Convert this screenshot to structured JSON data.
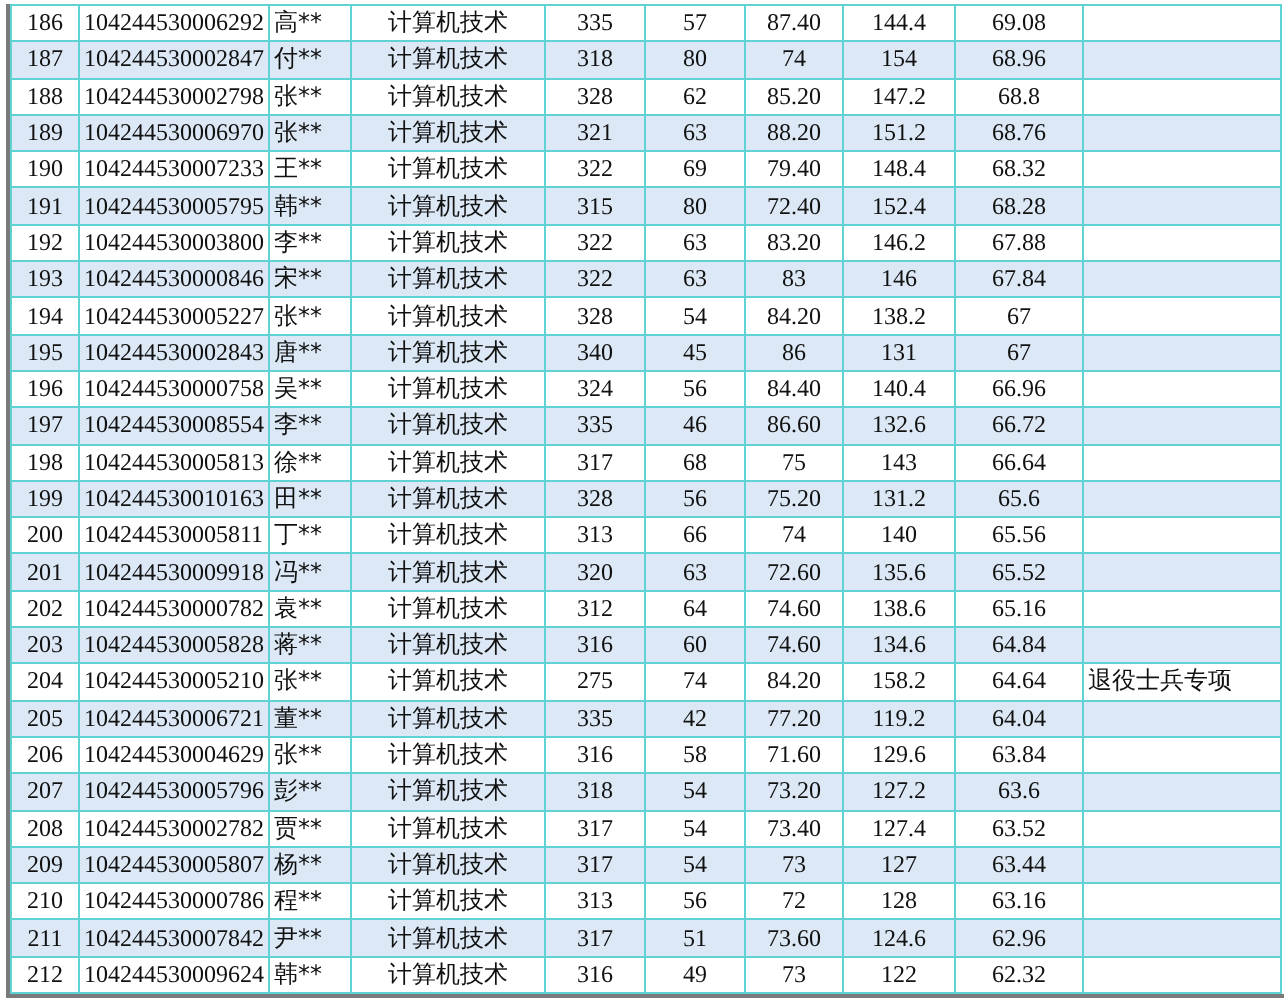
{
  "table": {
    "rows": [
      {
        "cells": [
          "186",
          "104244530006292",
          "高**",
          "计算机技术",
          "335",
          "57",
          "87.40",
          "144.4",
          "69.08"
        ]
      },
      {
        "cells": [
          "187",
          "104244530002847",
          "付**",
          "计算机技术",
          "318",
          "80",
          "74",
          "154",
          "68.96"
        ]
      },
      {
        "cells": [
          "188",
          "104244530002798",
          "张**",
          "计算机技术",
          "328",
          "62",
          "85.20",
          "147.2",
          "68.8"
        ]
      },
      {
        "cells": [
          "189",
          "104244530006970",
          "张**",
          "计算机技术",
          "321",
          "63",
          "88.20",
          "151.2",
          "68.76"
        ]
      },
      {
        "cells": [
          "190",
          "104244530007233",
          "王**",
          "计算机技术",
          "322",
          "69",
          "79.40",
          "148.4",
          "68.32"
        ]
      },
      {
        "cells": [
          "191",
          "104244530005795",
          "韩**",
          "计算机技术",
          "315",
          "80",
          "72.40",
          "152.4",
          "68.28"
        ]
      },
      {
        "cells": [
          "192",
          "104244530003800",
          "李**",
          "计算机技术",
          "322",
          "63",
          "83.20",
          "146.2",
          "67.88"
        ]
      },
      {
        "cells": [
          "193",
          "104244530000846",
          "宋**",
          "计算机技术",
          "322",
          "63",
          "83",
          "146",
          "67.84"
        ]
      },
      {
        "cells": [
          "194",
          "104244530005227",
          "张**",
          "计算机技术",
          "328",
          "54",
          "84.20",
          "138.2",
          "67"
        ]
      },
      {
        "cells": [
          "195",
          "104244530002843",
          "唐**",
          "计算机技术",
          "340",
          "45",
          "86",
          "131",
          "67"
        ]
      },
      {
        "cells": [
          "196",
          "104244530000758",
          "吴**",
          "计算机技术",
          "324",
          "56",
          "84.40",
          "140.4",
          "66.96"
        ]
      },
      {
        "cells": [
          "197",
          "104244530008554",
          "李**",
          "计算机技术",
          "335",
          "46",
          "86.60",
          "132.6",
          "66.72"
        ]
      },
      {
        "cells": [
          "198",
          "104244530005813",
          "徐**",
          "计算机技术",
          "317",
          "68",
          "75",
          "143",
          "66.64"
        ]
      },
      {
        "cells": [
          "199",
          "104244530010163",
          "田**",
          "计算机技术",
          "328",
          "56",
          "75.20",
          "131.2",
          "65.6"
        ]
      },
      {
        "cells": [
          "200",
          "104244530005811",
          "丁**",
          "计算机技术",
          "313",
          "66",
          "74",
          "140",
          "65.56"
        ]
      },
      {
        "cells": [
          "201",
          "104244530009918",
          "冯**",
          "计算机技术",
          "320",
          "63",
          "72.60",
          "135.6",
          "65.52"
        ]
      },
      {
        "cells": [
          "202",
          "104244530000782",
          "袁**",
          "计算机技术",
          "312",
          "64",
          "74.60",
          "138.6",
          "65.16"
        ]
      },
      {
        "cells": [
          "203",
          "104244530005828",
          "蒋**",
          "计算机技术",
          "316",
          "60",
          "74.60",
          "134.6",
          "64.84"
        ]
      },
      {
        "cells": [
          "204",
          "104244530005210",
          "张**",
          "计算机技术",
          "275",
          "74",
          "84.20",
          "158.2",
          "64.64",
          "退役士兵专项"
        ]
      },
      {
        "cells": [
          "205",
          "104244530006721",
          "董**",
          "计算机技术",
          "335",
          "42",
          "77.20",
          "119.2",
          "64.04"
        ]
      },
      {
        "cells": [
          "206",
          "104244530004629",
          "张**",
          "计算机技术",
          "316",
          "58",
          "71.60",
          "129.6",
          "63.84"
        ]
      },
      {
        "cells": [
          "207",
          "104244530005796",
          "彭**",
          "计算机技术",
          "318",
          "54",
          "73.20",
          "127.2",
          "63.6"
        ]
      },
      {
        "cells": [
          "208",
          "104244530002782",
          "贾**",
          "计算机技术",
          "317",
          "54",
          "73.40",
          "127.4",
          "63.52"
        ]
      },
      {
        "cells": [
          "209",
          "104244530005807",
          "杨**",
          "计算机技术",
          "317",
          "54",
          "73",
          "127",
          "63.44"
        ]
      },
      {
        "cells": [
          "210",
          "104244530000786",
          "程**",
          "计算机技术",
          "313",
          "56",
          "72",
          "128",
          "63.16"
        ]
      },
      {
        "cells": [
          "211",
          "104244530007842",
          "尹**",
          "计算机技术",
          "317",
          "51",
          "73.60",
          "124.6",
          "62.96"
        ]
      },
      {
        "cells": [
          "212",
          "104244530009624",
          "韩**",
          "计算机技术",
          "316",
          "49",
          "73",
          "122",
          "62.32"
        ]
      }
    ]
  }
}
